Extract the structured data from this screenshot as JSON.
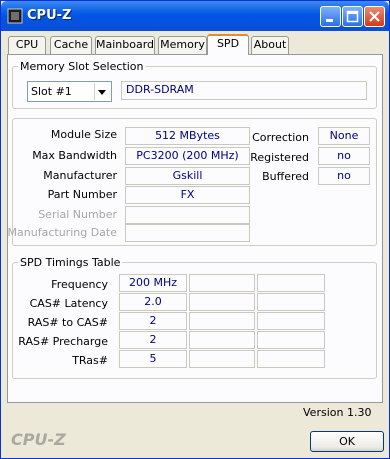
{
  "window": {
    "title": "CPU-Z"
  },
  "tabs": [
    {
      "label": "CPU",
      "active": false
    },
    {
      "label": "Cache",
      "active": false
    },
    {
      "label": "Mainboard",
      "active": false
    },
    {
      "label": "Memory",
      "active": false
    },
    {
      "label": "SPD",
      "active": true
    },
    {
      "label": "About",
      "active": false
    }
  ],
  "slot_selection": {
    "legend": "Memory Slot Selection",
    "slot": "Slot #1",
    "type": "DDR-SDRAM"
  },
  "module": {
    "module_size": {
      "label": "Module Size",
      "value": "512 MBytes"
    },
    "max_bandwidth": {
      "label": "Max Bandwidth",
      "value": "PC3200 (200 MHz)"
    },
    "manufacturer": {
      "label": "Manufacturer",
      "value": "Gskill"
    },
    "part_number": {
      "label": "Part Number",
      "value": "FX"
    },
    "serial_number": {
      "label": "Serial Number",
      "value": ""
    },
    "manufacturing_date": {
      "label": "Manufacturing Date",
      "value": ""
    },
    "correction": {
      "label": "Correction",
      "value": "None"
    },
    "registered": {
      "label": "Registered",
      "value": "no"
    },
    "buffered": {
      "label": "Buffered",
      "value": "no"
    }
  },
  "timings": {
    "legend": "SPD Timings Table",
    "rows": [
      {
        "label": "Frequency",
        "value": "200 MHz"
      },
      {
        "label": "CAS# Latency",
        "value": "2.0"
      },
      {
        "label": "RAS# to CAS#",
        "value": "2"
      },
      {
        "label": "RAS# Precharge",
        "value": "2"
      },
      {
        "label": "TRas#",
        "value": "5"
      }
    ]
  },
  "footer": {
    "version": "Version 1.30",
    "brand": "CPU-Z",
    "ok_label": "OK"
  },
  "colors": {
    "title_bar": "#0055e5",
    "value_text": "#000080",
    "active_tab_accent": "#e68b2c"
  }
}
